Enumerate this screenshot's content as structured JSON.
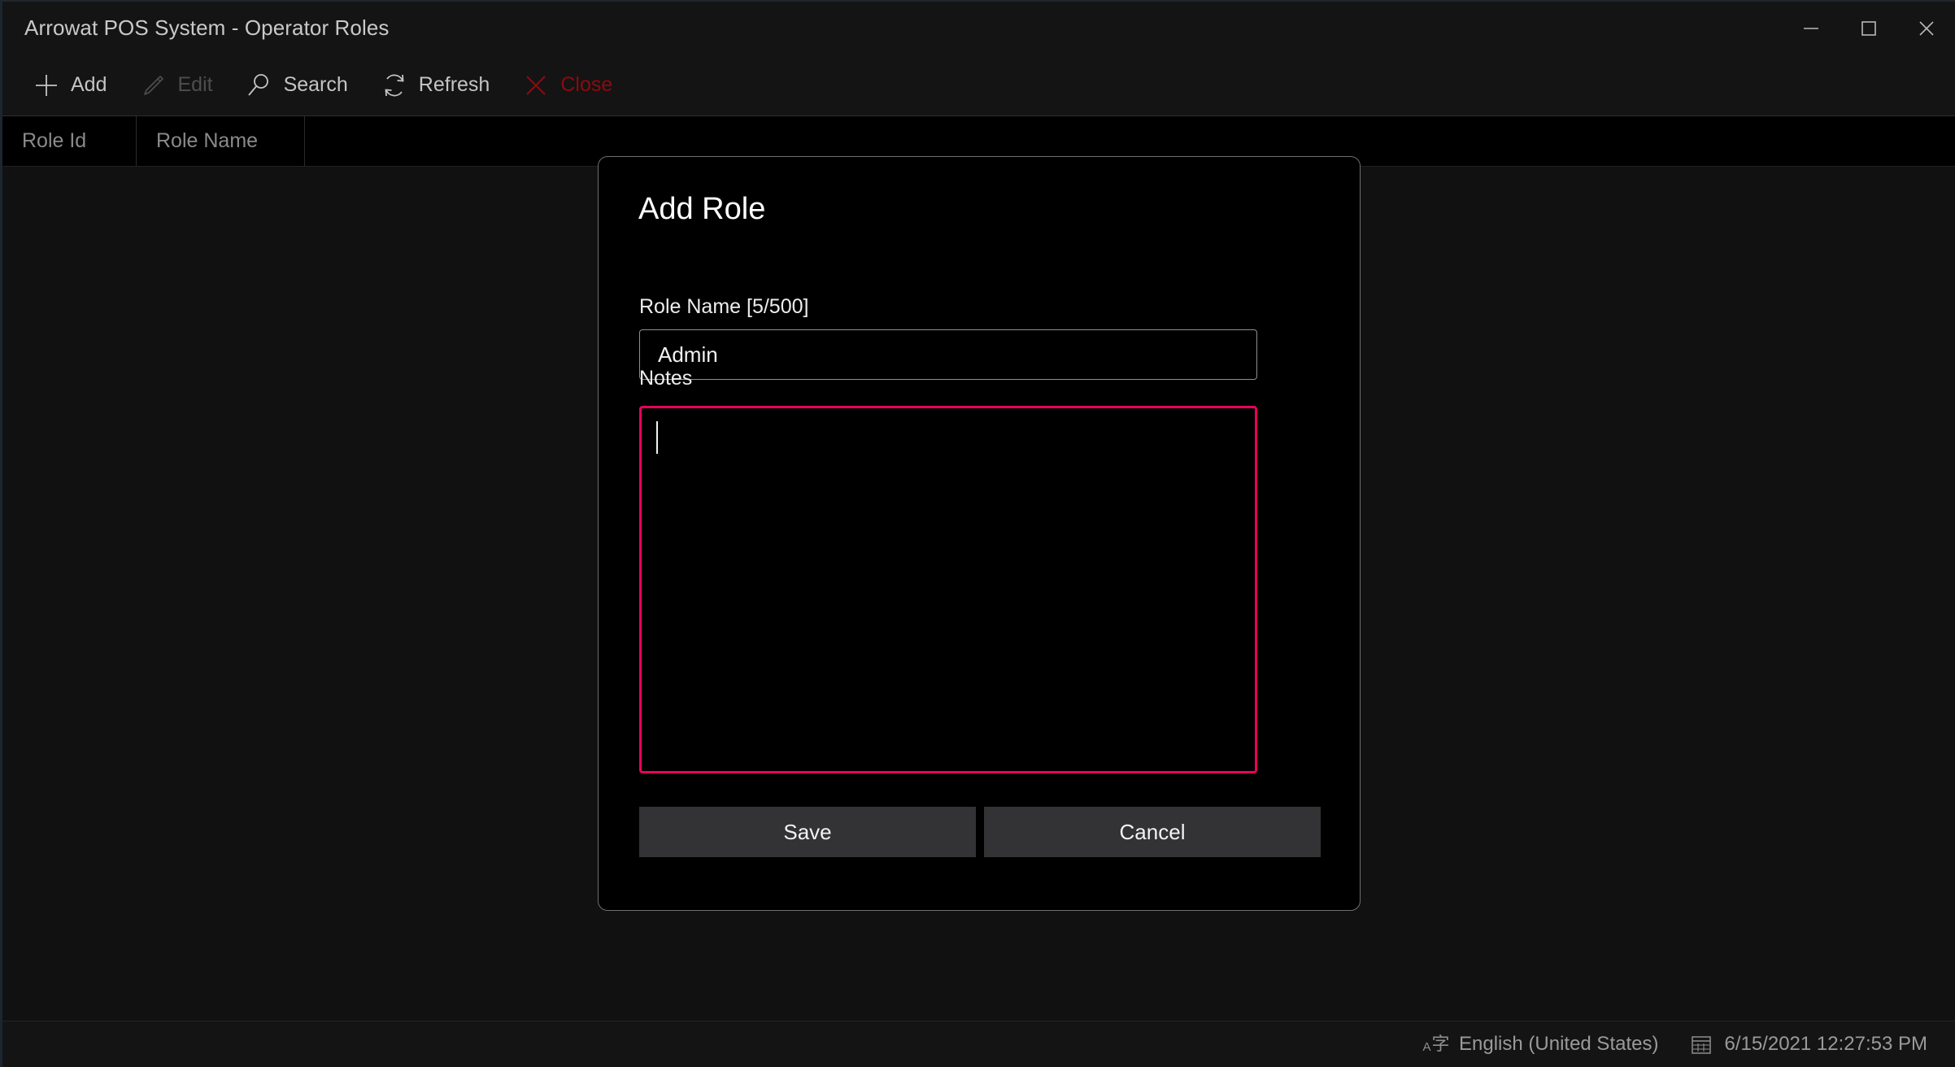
{
  "window": {
    "title": "Arrowat POS System - Operator Roles",
    "controls": [
      {
        "name": "minimize",
        "label": "Minimize"
      },
      {
        "name": "maximize",
        "label": "Maximize"
      },
      {
        "name": "close",
        "label": "Close"
      }
    ]
  },
  "toolbar": {
    "items": [
      {
        "label": "Add",
        "icon": "plus-icon",
        "state": "enabled"
      },
      {
        "label": "Edit",
        "icon": "pencil-icon",
        "state": "disabled"
      },
      {
        "label": "Search",
        "icon": "search-icon",
        "state": "enabled"
      },
      {
        "label": "Refresh",
        "icon": "refresh-icon",
        "state": "enabled"
      },
      {
        "label": "Close",
        "icon": "x-icon",
        "state": "danger"
      }
    ]
  },
  "grid": {
    "columns": [
      "Role Id",
      "Role Name",
      ""
    ],
    "rows": []
  },
  "dialog": {
    "title": "Add Role",
    "role_name": {
      "label": "Role Name [5/500]",
      "value": "Admin",
      "placeholder": ""
    },
    "notes": {
      "label": "Notes",
      "value": "",
      "placeholder": ""
    },
    "save_label": "Save",
    "cancel_label": "Cancel"
  },
  "statusbar": {
    "language": "English (United States)",
    "language_icon_small": "A",
    "language_icon_big": "字",
    "datetime": "6/15/2021 12:27:53 PM"
  },
  "colors": {
    "accent_focus": "#e8005c",
    "danger": "#8d0a0e",
    "window_bg": "#111112",
    "chrome_bg": "#141415",
    "dialog_bg": "#000000",
    "button_bg": "#333335"
  }
}
